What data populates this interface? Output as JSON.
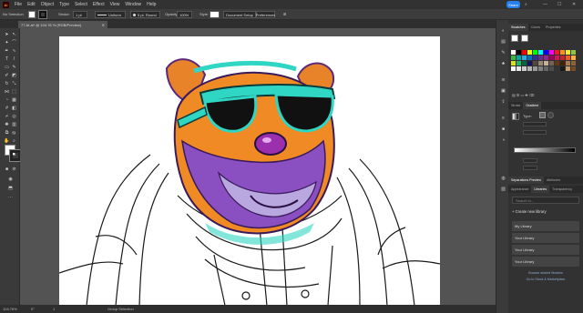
{
  "app": {
    "logo": "Ai"
  },
  "menu": [
    "File",
    "Edit",
    "Object",
    "Type",
    "Select",
    "Effect",
    "View",
    "Window",
    "Help"
  ],
  "share_label": "Share",
  "control": {
    "selection": "No Selection",
    "stroke_label": "Stroke:",
    "stroke_value": "1 pt",
    "uniform": "Uniform",
    "brush": "5 pt. Round",
    "opacity_label": "Opacity:",
    "opacity_value": "100%",
    "style_label": "Style:",
    "doc_setup": "Document Setup",
    "preferences": "Preferences"
  },
  "document_tab": "77.AI.ai* @ 104.76 % (RGB/Preview)",
  "status": {
    "zoom": "104.76%",
    "rotation": "0°",
    "artboard": "1",
    "mode": "Group Selection"
  },
  "panels": {
    "swatch_tabs": [
      "Swatches",
      "Colors",
      "Properties"
    ],
    "gradient_tabs": [
      "Stroke",
      "Gradient"
    ],
    "gradient_type_label": "Type:",
    "layer_tabs": [
      "Appearance",
      "Libraries",
      "Transparency"
    ],
    "sep_tabs": [
      "Separations Preview",
      "Attributes"
    ],
    "search_placeholder": "Search in...",
    "create_library": "+ Create new library",
    "libraries": [
      "My Library",
      "Your Library",
      "Your Library",
      "Your Library"
    ],
    "browse_link": "Browse shared libraries",
    "stock_link": "Go to Stock & Marketplace"
  },
  "colors": {
    "accent": "#2680eb",
    "swatches": [
      "#ffffff",
      "#000000",
      "#ff0000",
      "#ffff00",
      "#00ff00",
      "#00ffff",
      "#0000ff",
      "#ff00ff",
      "#ed1c24",
      "#f7931e",
      "#fcee21",
      "#8cc63f",
      "#39b54a",
      "#00a99d",
      "#29abe2",
      "#0071bc",
      "#2e3192",
      "#662d91",
      "#93278f",
      "#9e005d",
      "#d4145a",
      "#c1272d",
      "#f15a24",
      "#fbb03b",
      "#d9e021",
      "#22b573",
      "#006837",
      "#1b1464",
      "#534741",
      "#998675",
      "#c7b299",
      "#736357",
      "#603813",
      "#42210b",
      "#a67c52",
      "#8c6239",
      "#ffffff",
      "#e6e6e6",
      "#cccccc",
      "#b3b3b3",
      "#999999",
      "#808080",
      "#666666",
      "#4d4d4d",
      "#333333",
      "#1a1a1a",
      "#c69c6d",
      "#754c24"
    ]
  }
}
